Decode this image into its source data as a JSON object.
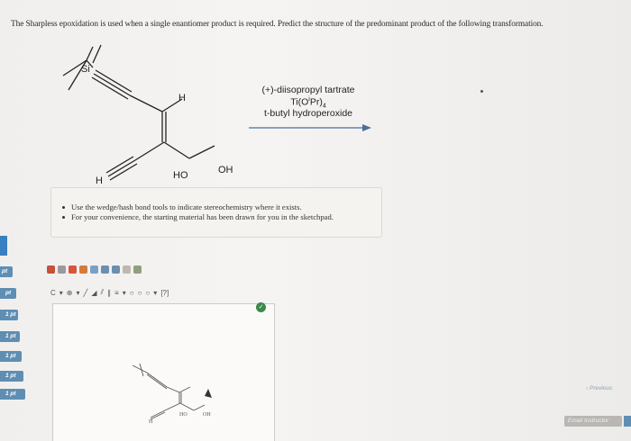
{
  "question": {
    "text": "The Sharpless epoxidation is used when a single enantiomer product is required. Predict the structure of the predominant product of the following transformation."
  },
  "reaction": {
    "atoms": {
      "si": "Si",
      "h_top": "H",
      "h_bottom": "H",
      "ho": "HO",
      "oh": "OH"
    },
    "reagents": {
      "line1": "(+)-diisopropyl tartrate",
      "line2": "Ti(O",
      "line2_sup": "i",
      "line2_b": "Pr)",
      "line2_sub": "4",
      "line3": "t-butyl hydroperoxide"
    }
  },
  "hints": {
    "item1": "Use the wedge/hash bond tools to indicate stereochemistry where it exists.",
    "item2": "For your convenience, the starting material has been drawn for you in the sketchpad."
  },
  "side_tabs": [
    "pt",
    "pt",
    "1 pt",
    "1 pt",
    "1 pt",
    "1 pt",
    "1 pt"
  ],
  "toolbar": {
    "dropdown_c": "C",
    "ring_label": "[?]"
  },
  "sketch": {
    "ho": "HO",
    "oh": "OH",
    "h": "H"
  },
  "nav": {
    "previous": "Previous",
    "email": "Email Instructor"
  },
  "colors": {
    "accent": "#5e8eb4",
    "check": "#3b8a4a"
  }
}
